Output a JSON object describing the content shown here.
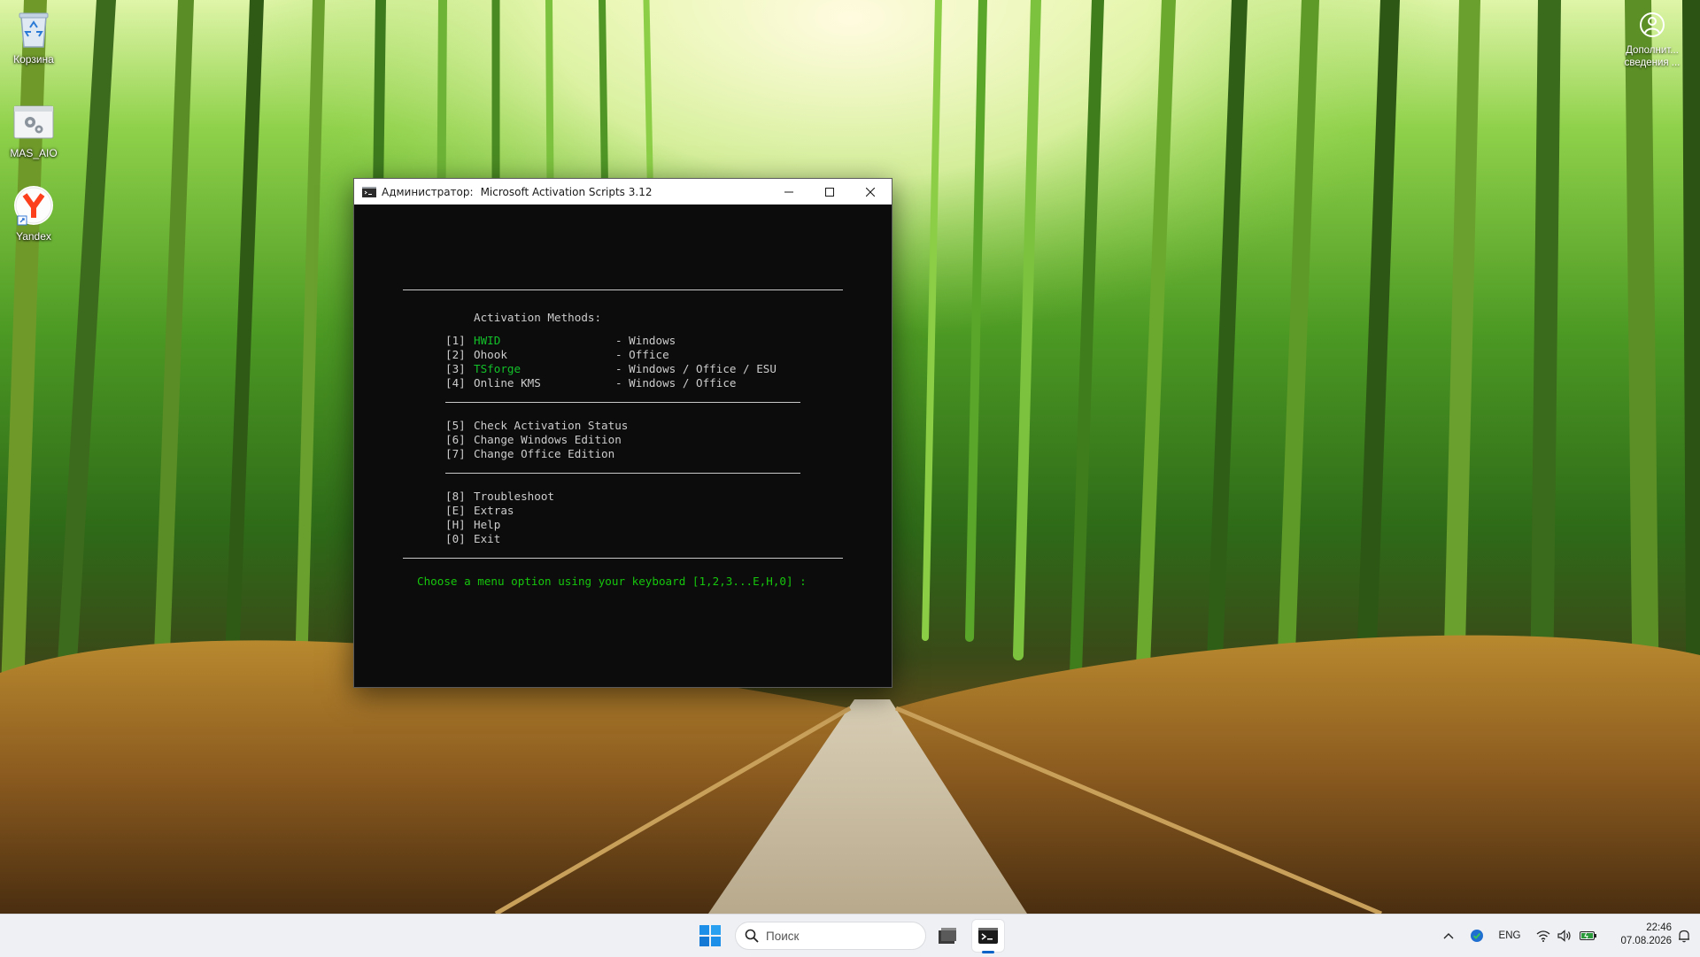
{
  "desktop": {
    "icons": [
      {
        "label": "Корзина",
        "icon": "recycle-bin-icon"
      },
      {
        "label": "MAS_AIO",
        "icon": "batch-file-icon"
      },
      {
        "label": "Yandex",
        "icon": "yandex-browser-icon"
      }
    ],
    "corner_info": {
      "label_line1": "Дополнит...",
      "label_line2": "сведения ...",
      "icon": "info-circle-icon"
    }
  },
  "window": {
    "title_prefix": "Администратор:",
    "title": "Microsoft Activation Scripts 3.12",
    "controls": {
      "minimize": "minimize-icon",
      "maximize": "maximize-icon",
      "close": "close-icon"
    },
    "colors": {
      "background": "#0c0c0c",
      "text": "#cccccc",
      "highlight": "#13c12a"
    }
  },
  "menu": {
    "heading": "Activation Methods:",
    "methods": [
      {
        "key": "[1]",
        "name": "HWID",
        "target": "- Windows",
        "highlight": true
      },
      {
        "key": "[2]",
        "name": "Ohook",
        "target": "- Office",
        "highlight": false
      },
      {
        "key": "[3]",
        "name": "TSforge",
        "target": "- Windows / Office / ESU",
        "highlight": true
      },
      {
        "key": "[4]",
        "name": "Online KMS",
        "target": "- Windows / Office",
        "highlight": false
      }
    ],
    "tools": [
      {
        "key": "[5]",
        "name": "Check Activation Status"
      },
      {
        "key": "[6]",
        "name": "Change Windows Edition"
      },
      {
        "key": "[7]",
        "name": "Change Office Edition"
      }
    ],
    "misc": [
      {
        "key": "[8]",
        "name": "Troubleshoot"
      },
      {
        "key": "[E]",
        "name": "Extras"
      },
      {
        "key": "[H]",
        "name": "Help"
      },
      {
        "key": "[0]",
        "name": "Exit"
      }
    ],
    "prompt": "Choose a menu option using your keyboard [1,2,3...E,H,0] :"
  },
  "taskbar": {
    "search_placeholder": "Поиск",
    "language": "ENG",
    "time": "22:46",
    "date": "07.08.2026",
    "icons": [
      "windows-start-icon",
      "search-icon",
      "file-explorer-icon",
      "terminal-icon",
      "chevron-up-icon",
      "security-shield-icon",
      "wifi-icon",
      "volume-icon",
      "battery-icon",
      "notification-icon"
    ]
  }
}
